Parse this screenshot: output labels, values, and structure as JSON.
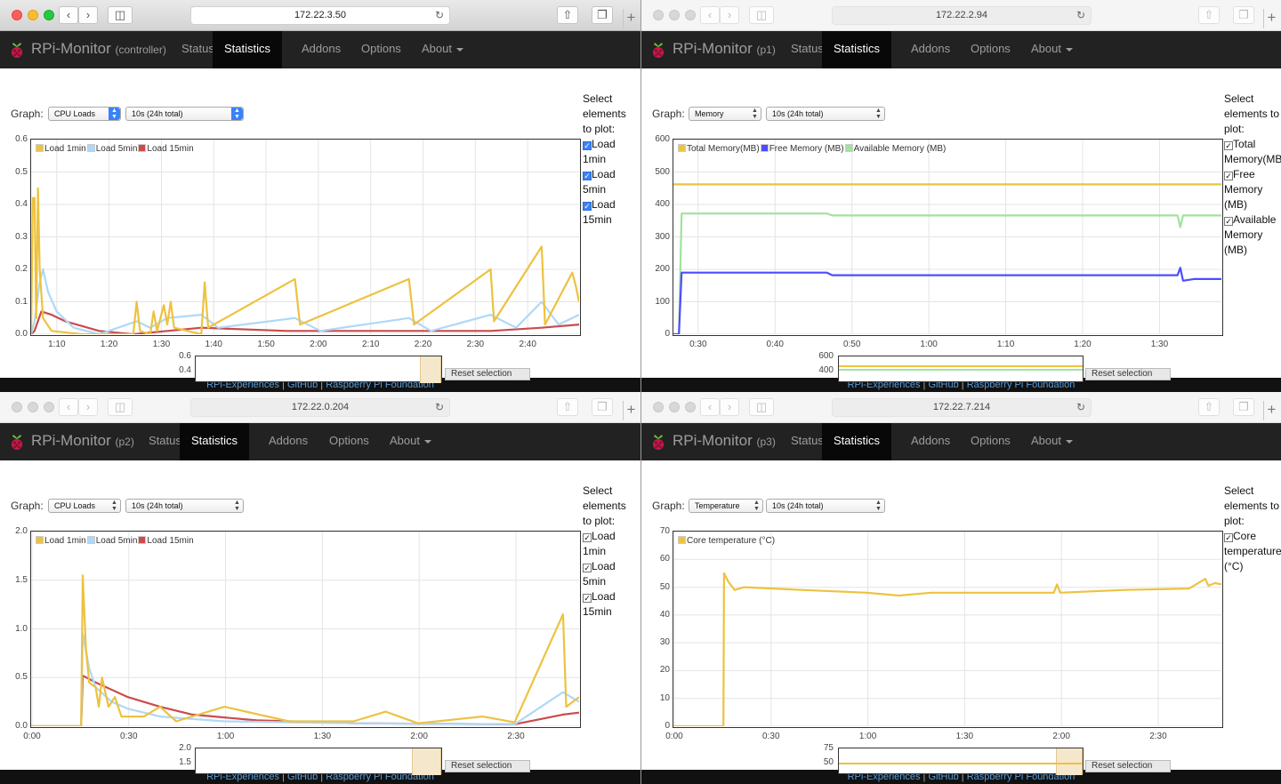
{
  "windows": [
    {
      "id": "w0",
      "url": "172.22.3.50",
      "brand": "RPi-Monitor",
      "host": "(controller)",
      "graph_select": "CPU Loads",
      "range_select": "10s (24h total)",
      "select_label": [
        "Select",
        "elements",
        "to plot:"
      ],
      "checkboxes": [
        "Load",
        "1min",
        "Load",
        "5min",
        "Load",
        "15min"
      ],
      "overview_ticks": [
        "0.6",
        "0.4"
      ],
      "reset_label": "Reset selection"
    },
    {
      "id": "w1",
      "url": "172.22.2.94",
      "brand": "RPi-Monitor",
      "host": "(p1)",
      "graph_select": "Memory",
      "range_select": "10s (24h total)",
      "select_label": [
        "Select",
        "elements to",
        "plot:"
      ],
      "checkboxes": [
        "Total",
        "Memory(MB",
        "Free",
        "Memory",
        "(MB)",
        "Available",
        "Memory",
        "(MB)"
      ],
      "overview_ticks": [
        "600",
        "400"
      ],
      "reset_label": "Reset selection"
    },
    {
      "id": "w2",
      "url": "172.22.0.204",
      "brand": "RPi-Monitor",
      "host": "(p2)",
      "graph_select": "CPU Loads",
      "range_select": "10s (24h total)",
      "select_label": [
        "Select",
        "elements",
        "to plot:"
      ],
      "checkboxes": [
        "Load",
        "1min",
        "Load",
        "5min",
        "Load",
        "15min"
      ],
      "overview_ticks": [
        "2.0",
        "1.5"
      ],
      "reset_label": "Reset selection"
    },
    {
      "id": "w3",
      "url": "172.22.7.214",
      "brand": "RPi-Monitor",
      "host": "(p3)",
      "graph_select": "Temperature",
      "range_select": "10s (24h total)",
      "select_label": [
        "Select",
        "elements to",
        "plot:"
      ],
      "checkboxes": [
        "Core",
        "temperature",
        "(°C)"
      ],
      "overview_ticks": [
        "75",
        "50"
      ],
      "reset_label": "Reset selection"
    }
  ],
  "nav": {
    "status": "Status",
    "statistics": "Statistics",
    "addons": "Addons",
    "options": "Options",
    "about": "About"
  },
  "graph_label": "Graph:",
  "footer": {
    "link1": "RPi-Experiences",
    "sep1": " | ",
    "link2": "GitHub",
    "sep2": " | ",
    "link3": "Raspberry Pi Foundation"
  },
  "colors": {
    "load1": "#edc240",
    "load5": "#afd8f8",
    "load15": "#cb4b4b",
    "free_mem": "#4d4dff",
    "available_mem": "#4da74d"
  },
  "chart_data": [
    {
      "type": "line",
      "title": "",
      "xlabel": "",
      "ylabel": "",
      "x": [
        "1:05",
        "1:10",
        "1:20",
        "1:30",
        "1:40",
        "1:50",
        "2:00",
        "2:10",
        "2:20",
        "2:30",
        "2:40",
        "2:49"
      ],
      "x_ticks": [
        "1:10",
        "1:20",
        "1:30",
        "1:40",
        "1:50",
        "2:00",
        "2:10",
        "2:20",
        "2:30",
        "2:40"
      ],
      "y_ticks": [
        "0.0",
        "0.1",
        "0.2",
        "0.3",
        "0.4",
        "0.5",
        "0.6"
      ],
      "ylim": [
        0,
        0.6
      ],
      "legend_position": "top-left",
      "series": [
        {
          "name": "Load 1min",
          "points": [
            [
              0,
              0
            ],
            [
              1,
              0.42
            ],
            [
              2,
              0.42
            ],
            [
              3,
              0.05
            ],
            [
              4,
              0.45
            ],
            [
              5,
              0.2
            ],
            [
              7,
              0.05
            ],
            [
              12,
              0.01
            ],
            [
              30,
              0
            ],
            [
              60,
              0
            ],
            [
              62,
              0.1
            ],
            [
              64,
              0.01
            ],
            [
              70,
              0
            ],
            [
              72,
              0.07
            ],
            [
              74,
              0.01
            ],
            [
              78,
              0.09
            ],
            [
              80,
              0.03
            ],
            [
              82,
              0.1
            ],
            [
              84,
              0.02
            ],
            [
              100,
              0
            ],
            [
              102,
              0.16
            ],
            [
              104,
              0.02
            ],
            [
              155,
              0.17
            ],
            [
              158,
              0.03
            ],
            [
              222,
              0.17
            ],
            [
              225,
              0.03
            ],
            [
              270,
              0.2
            ],
            [
              272,
              0.04
            ],
            [
              300,
              0.27
            ],
            [
              302,
              0.03
            ],
            [
              318,
              0.19
            ],
            [
              320,
              0.15
            ],
            [
              322,
              0.1
            ]
          ]
        },
        {
          "name": "Load 5min",
          "points": [
            [
              0,
              0
            ],
            [
              2,
              0.04
            ],
            [
              5,
              0.16
            ],
            [
              7,
              0.2
            ],
            [
              10,
              0.13
            ],
            [
              15,
              0.07
            ],
            [
              25,
              0.02
            ],
            [
              40,
              0
            ],
            [
              62,
              0.04
            ],
            [
              70,
              0.02
            ],
            [
              80,
              0.05
            ],
            [
              100,
              0.06
            ],
            [
              110,
              0.02
            ],
            [
              155,
              0.05
            ],
            [
              170,
              0.01
            ],
            [
              222,
              0.05
            ],
            [
              235,
              0.01
            ],
            [
              270,
              0.06
            ],
            [
              285,
              0.02
            ],
            [
              300,
              0.1
            ],
            [
              310,
              0.03
            ],
            [
              322,
              0.06
            ]
          ]
        },
        {
          "name": "Load 15min",
          "points": [
            [
              0,
              0
            ],
            [
              2,
              0.01
            ],
            [
              6,
              0.07
            ],
            [
              12,
              0.06
            ],
            [
              20,
              0.04
            ],
            [
              40,
              0.01
            ],
            [
              60,
              0
            ],
            [
              100,
              0.02
            ],
            [
              150,
              0.01
            ],
            [
              222,
              0.01
            ],
            [
              270,
              0.01
            ],
            [
              300,
              0.02
            ],
            [
              322,
              0.03
            ]
          ]
        }
      ]
    },
    {
      "type": "line",
      "title": "",
      "xlabel": "",
      "ylabel": "",
      "x_ticks": [
        "0:30",
        "0:40",
        "0:50",
        "1:00",
        "1:10",
        "1:20",
        "1:30"
      ],
      "y_ticks": [
        "0",
        "100",
        "200",
        "300",
        "400",
        "500",
        "600"
      ],
      "ylim": [
        0,
        600
      ],
      "legend_position": "top-left",
      "series": [
        {
          "name": "Total Memory(MB)",
          "points": [
            [
              0,
              462
            ],
            [
              100,
              462
            ]
          ]
        },
        {
          "name": "Free Memory (MB)",
          "points": [
            [
              0,
              0
            ],
            [
              1,
              0
            ],
            [
              1.5,
              190
            ],
            [
              28,
              190
            ],
            [
              29,
              182
            ],
            [
              92,
              182
            ],
            [
              92.5,
              205
            ],
            [
              93,
              165
            ],
            [
              95,
              170
            ],
            [
              100,
              170
            ]
          ]
        },
        {
          "name": "Available Memory (MB)",
          "points": [
            [
              0,
              0
            ],
            [
              1,
              0
            ],
            [
              1.5,
              372
            ],
            [
              28,
              372
            ],
            [
              29,
              366
            ],
            [
              92,
              366
            ],
            [
              92.5,
              330
            ],
            [
              93,
              366
            ],
            [
              100,
              366
            ]
          ]
        }
      ]
    },
    {
      "type": "line",
      "title": "",
      "xlabel": "",
      "ylabel": "",
      "x_ticks": [
        "0:00",
        "0:30",
        "1:00",
        "1:30",
        "2:00",
        "2:30"
      ],
      "y_ticks": [
        "0.0",
        "0.5",
        "1.0",
        "1.5",
        "2.0"
      ],
      "ylim": [
        0,
        2.0
      ],
      "legend_position": "top-left",
      "series": [
        {
          "name": "Load 1min",
          "points": [
            [
              0,
              0
            ],
            [
              15.5,
              0
            ],
            [
              16,
              1.55
            ],
            [
              17,
              0.8
            ],
            [
              18,
              0.45
            ],
            [
              20,
              0.4
            ],
            [
              21,
              0.2
            ],
            [
              22,
              0.5
            ],
            [
              24,
              0.2
            ],
            [
              26,
              0.3
            ],
            [
              28,
              0.1
            ],
            [
              35,
              0.1
            ],
            [
              40,
              0.2
            ],
            [
              45,
              0.05
            ],
            [
              60,
              0.2
            ],
            [
              80,
              0.05
            ],
            [
              100,
              0.05
            ],
            [
              110,
              0.15
            ],
            [
              120,
              0.03
            ],
            [
              140,
              0.1
            ],
            [
              150,
              0.04
            ],
            [
              165,
              1.15
            ],
            [
              166,
              0.2
            ],
            [
              170,
              0.3
            ]
          ]
        },
        {
          "name": "Load 5min",
          "points": [
            [
              0,
              0
            ],
            [
              15.5,
              0
            ],
            [
              16,
              0.95
            ],
            [
              18,
              0.6
            ],
            [
              20,
              0.4
            ],
            [
              25,
              0.25
            ],
            [
              30,
              0.18
            ],
            [
              40,
              0.1
            ],
            [
              60,
              0.05
            ],
            [
              100,
              0.03
            ],
            [
              150,
              0.02
            ],
            [
              165,
              0.35
            ],
            [
              170,
              0.25
            ]
          ]
        },
        {
          "name": "Load 15min",
          "points": [
            [
              0,
              0
            ],
            [
              15.5,
              0
            ],
            [
              16,
              0.52
            ],
            [
              20,
              0.45
            ],
            [
              30,
              0.3
            ],
            [
              40,
              0.2
            ],
            [
              50,
              0.12
            ],
            [
              70,
              0.06
            ],
            [
              100,
              0.03
            ],
            [
              150,
              0.02
            ],
            [
              165,
              0.12
            ],
            [
              170,
              0.14
            ]
          ]
        }
      ]
    },
    {
      "type": "line",
      "title": "",
      "xlabel": "",
      "ylabel": "",
      "x_ticks": [
        "0:00",
        "0:30",
        "1:00",
        "1:30",
        "2:00",
        "2:30"
      ],
      "y_ticks": [
        "0",
        "10",
        "20",
        "30",
        "40",
        "50",
        "60",
        "70"
      ],
      "ylim": [
        0,
        70
      ],
      "legend_position": "top-left",
      "series": [
        {
          "name": "Core temperature (°C)",
          "points": [
            [
              0,
              0
            ],
            [
              15.5,
              0
            ],
            [
              15.7,
              55
            ],
            [
              17,
              52
            ],
            [
              19,
              49
            ],
            [
              22,
              50
            ],
            [
              40,
              49
            ],
            [
              60,
              48
            ],
            [
              70,
              47
            ],
            [
              80,
              48
            ],
            [
              100,
              48
            ],
            [
              118,
              48
            ],
            [
              119,
              51
            ],
            [
              120,
              48
            ],
            [
              140,
              49
            ],
            [
              160,
              49.5
            ],
            [
              165,
              53
            ],
            [
              166,
              50.5
            ],
            [
              168,
              51.5
            ],
            [
              170,
              51
            ]
          ]
        }
      ]
    }
  ]
}
